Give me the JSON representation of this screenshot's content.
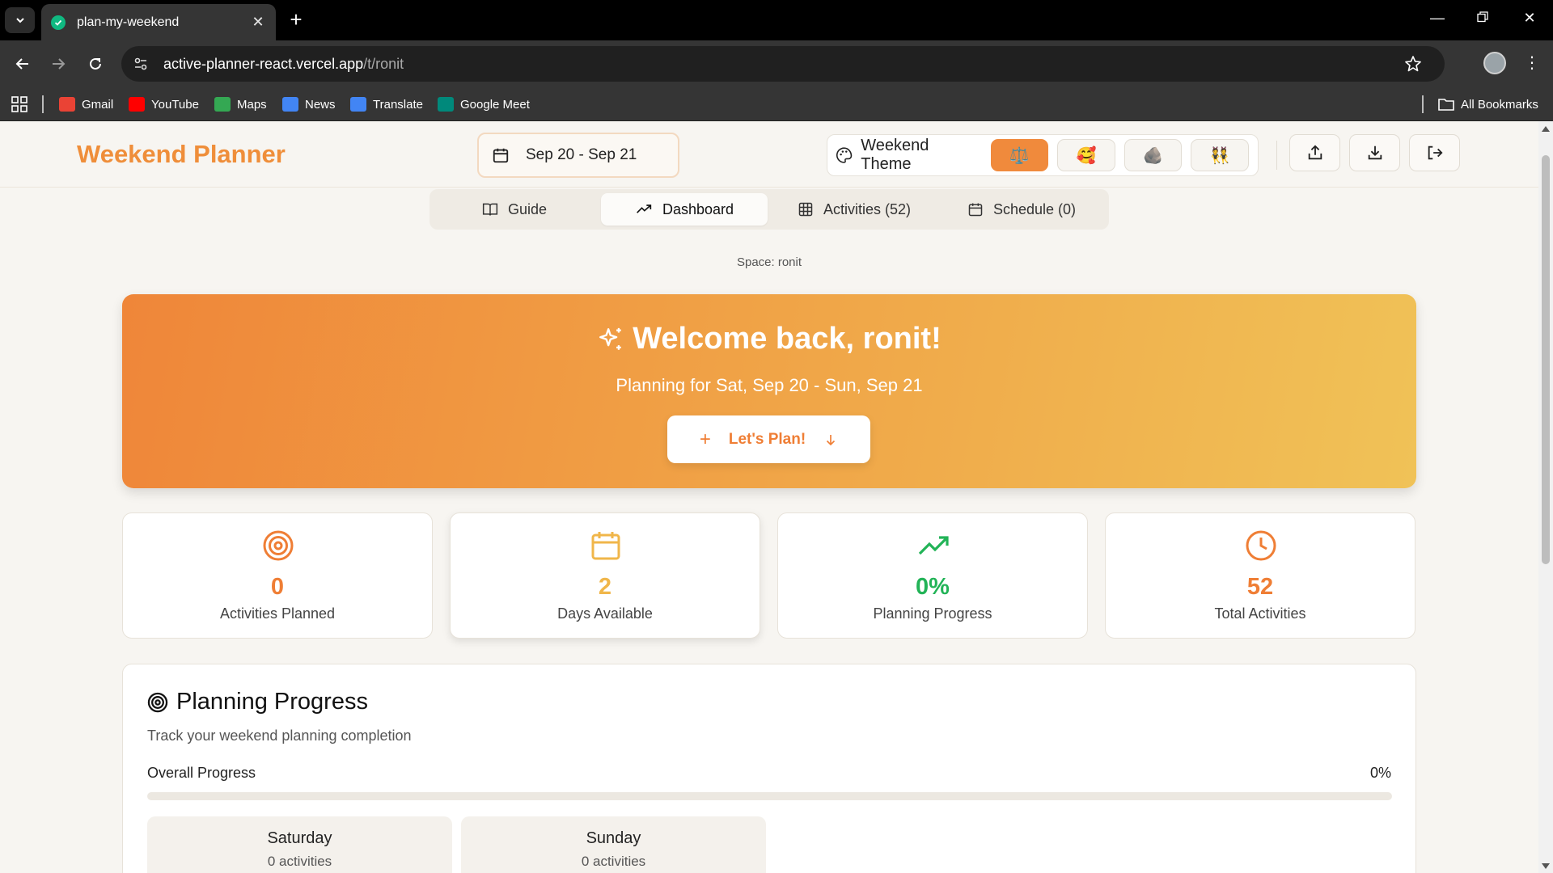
{
  "browser": {
    "tab_title": "plan-my-weekend",
    "url_host": "active-planner-react.vercel.app",
    "url_path": "/t/ronit",
    "bookmarks": [
      {
        "label": "Gmail",
        "icon": "gmail-icon",
        "color": "#ea4335"
      },
      {
        "label": "YouTube",
        "icon": "youtube-icon",
        "color": "#ff0000"
      },
      {
        "label": "Maps",
        "icon": "maps-icon",
        "color": "#34a853"
      },
      {
        "label": "News",
        "icon": "news-icon",
        "color": "#4285f4"
      },
      {
        "label": "Translate",
        "icon": "translate-icon",
        "color": "#4285f4"
      },
      {
        "label": "Google Meet",
        "icon": "meet-icon",
        "color": "#00897b"
      }
    ],
    "all_bookmarks": "All Bookmarks"
  },
  "header": {
    "brand": "Weekend Planner",
    "date_range": "Sep 20 - Sep 21",
    "theme_label": "Weekend Theme",
    "themes": [
      "⚖️",
      "🥰",
      "🪨",
      "👯"
    ]
  },
  "tabs": [
    {
      "label": "Guide",
      "icon": "book-icon"
    },
    {
      "label": "Dashboard",
      "icon": "trend-icon"
    },
    {
      "label": "Activities (52)",
      "icon": "grid-icon"
    },
    {
      "label": "Schedule (0)",
      "icon": "calendar-icon"
    }
  ],
  "space_label": "Space: ronit",
  "hero": {
    "title": "Welcome back, ronit!",
    "subtitle": "Planning for Sat, Sep 20 - Sun, Sep 21",
    "cta": "Let's Plan!"
  },
  "stats": [
    {
      "value": "0",
      "label": "Activities Planned",
      "icon": "target-icon",
      "color": "#ef7e35"
    },
    {
      "value": "2",
      "label": "Days Available",
      "icon": "calendar-icon",
      "color": "#f0b64a"
    },
    {
      "value": "0%",
      "label": "Planning Progress",
      "icon": "trending-up-icon",
      "color": "#22b357"
    },
    {
      "value": "52",
      "label": "Total Activities",
      "icon": "clock-icon",
      "color": "#ef7e35"
    }
  ],
  "progress": {
    "title": "Planning Progress",
    "subtitle": "Track your weekend planning completion",
    "overall_label": "Overall Progress",
    "overall_pct": "0%",
    "overall_fraction": 0,
    "days": [
      {
        "name": "Saturday",
        "count": "0 activities"
      },
      {
        "name": "Sunday",
        "count": "0 activities"
      }
    ]
  },
  "colors": {
    "accent": "#ef8e3a",
    "green": "#22b357"
  }
}
